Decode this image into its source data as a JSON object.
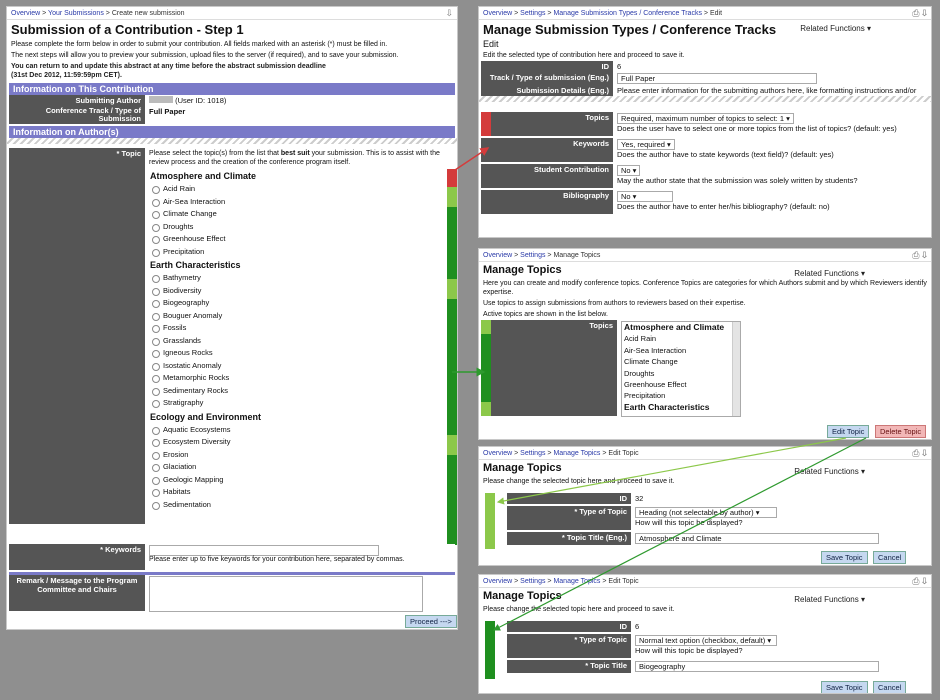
{
  "left": {
    "breadcrumb": [
      "Overview",
      "Your Submissions",
      "Create new submission"
    ],
    "title": "Submission of a Contribution - Step 1",
    "intro1": "Please complete the form below in order to submit your contribution. All fields marked with an asterisk (*) must be filled in.",
    "intro2": "The next steps will allow you to preview your submission, upload files to the server (if required), and to save your submission.",
    "notice1": "You can return to and update this abstract at any time before the abstract submission deadline",
    "notice2": "(31st Dec 2012, 11:59:59pm CET).",
    "sec_contribution": "Information on This Contribution",
    "author_label": "Submitting Author",
    "author_value": "(User ID: 1018)",
    "track_label": "Conference Track / Type of Submission",
    "track_value": "Full Paper",
    "sec_authors": "Information on Author(s)",
    "topic_label": "* Topic",
    "topic_help_a": "Please select the topic(s) from the list that",
    "topic_help_b": "best suit",
    "topic_help_c": "your submission. This is to assist with the review process and the creation of the conference program itself.",
    "categories": [
      {
        "name": "Atmosphere and Climate",
        "topics": [
          "Acid Rain",
          "Air-Sea Interaction",
          "Climate Change",
          "Droughts",
          "Greenhouse Effect",
          "Precipitation"
        ]
      },
      {
        "name": "Earth Characteristics",
        "topics": [
          "Bathymetry",
          "Biodiversity",
          "Biogeography",
          "Bouguer Anomaly",
          "Fossils",
          "Grasslands",
          "Igneous Rocks",
          "Isostatic Anomaly",
          "Metamorphic Rocks",
          "Sedimentary Rocks",
          "Stratigraphy"
        ]
      },
      {
        "name": "Ecology and Environment",
        "topics": [
          "Aquatic Ecosystems",
          "Ecosystem Diversity",
          "Erosion",
          "Glaciation",
          "Geologic Mapping",
          "Habitats",
          "Sedimentation"
        ]
      }
    ],
    "keywords_label": "* Keywords",
    "keywords_help": "Please enter up to five keywords for your contribution here, separated by commas.",
    "remark_label": "Remark / Message to the Program Committee and Chairs",
    "proceed": "Proceed --->"
  },
  "p1": {
    "breadcrumb": [
      "Overview",
      "Settings",
      "Manage Submission Types / Conference Tracks",
      "Edit"
    ],
    "title": "Manage Submission Types / Conference Tracks",
    "subtitle": "Edit",
    "related": "Related Functions",
    "desc": "Edit the selected type of contribution here and proceed to save it.",
    "id_label": "ID",
    "id_value": "6",
    "track_label": "Track / Type of submission",
    "track_lang": "(Eng.)",
    "track_value": "Full Paper",
    "details_label": "Submission Details",
    "details_lang": "(Eng.)",
    "details_value": "Please enter information for the submitting authors here, like formatting instructions and/or",
    "topics_label": "Topics",
    "topics_value": "Required, maximum number of topics to select: 1",
    "topics_help": "Does the user have to select one or more topics from the list of topics? (default: yes)",
    "keywords_label": "Keywords",
    "keywords_value": "Yes, required",
    "keywords_help": "Does the author have to state keywords (text field)? (default: yes)",
    "student_label": "Student Contribution",
    "student_value": "No",
    "student_help": "May the author state that the submission was solely written by students?",
    "biblio_label": "Bibliography",
    "biblio_value": "No",
    "biblio_help": "Does the author have to enter her/his bibliography? (default: no)"
  },
  "p2": {
    "breadcrumb": [
      "Overview",
      "Settings",
      "Manage Topics"
    ],
    "title": "Manage Topics",
    "related": "Related Functions",
    "desc1": "Here you can create and modify conference topics. Conference Topics are categories for which Authors submit and by which Reviewers identify expertise.",
    "desc2": "Use topics to assign submissions from authors to reviewers based on their expertise.",
    "desc3": "Active topics are shown in the list below.",
    "topics_label": "Topics",
    "list": [
      "Atmosphere and Climate",
      "Acid Rain",
      "Air-Sea Interaction",
      "Climate Change",
      "Droughts",
      "Greenhouse Effect",
      "Precipitation",
      "Earth Characteristics"
    ],
    "edit_btn": "Edit Topic",
    "delete_btn": "Delete Topic"
  },
  "p3": {
    "breadcrumb": [
      "Overview",
      "Settings",
      "Manage Topics",
      "Edit Topic"
    ],
    "title": "Manage Topics",
    "related": "Related Functions",
    "desc": "Please change the selected topic here and proceed to save it.",
    "id_label": "ID",
    "id_value": "32",
    "type_label": "* Type of Topic",
    "type_value": "Heading (not selectable by author)",
    "type_help": "How will this topic be displayed?",
    "title_label": "* Topic Title",
    "title_lang": "(Eng.)",
    "title_value": "Atmosphere and Climate",
    "save": "Save Topic",
    "cancel": "Cancel"
  },
  "p4": {
    "breadcrumb": [
      "Overview",
      "Settings",
      "Manage Topics",
      "Edit Topic"
    ],
    "title": "Manage Topics",
    "related": "Related Functions",
    "desc": "Please change the selected topic here and proceed to save it.",
    "id_label": "ID",
    "id_value": "6",
    "type_label": "* Type of Topic",
    "type_value": "Normal text option (checkbox, default)",
    "type_help": "How will this topic be displayed?",
    "title_label": "* Topic Title",
    "title_value": "Biogeography",
    "save": "Save Topic",
    "cancel": "Cancel"
  },
  "colors": {
    "dark_green": "#1f8f1f",
    "light_green": "#8cc84a",
    "red": "#d43b3b",
    "section_blue": "#7a7ac8",
    "label_gray": "#555555"
  }
}
